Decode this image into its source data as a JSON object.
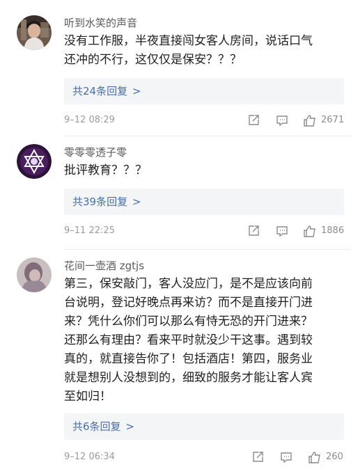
{
  "comments": [
    {
      "username": "听到水笑的声音",
      "lines": [
        "没有工作服，半夜直接闯女客人房间，说话口气",
        "还冲的不行，这仅仅是保安？？？"
      ],
      "replies": "共24条回复",
      "date": "9–12 08:29",
      "likes": "2671"
    },
    {
      "username": "零零零透子零",
      "lines": [
        "批评教育？？？"
      ],
      "replies": "共39条回复",
      "date": "9–11 22:25",
      "likes": "1886"
    },
    {
      "username": "花间一壶酒 zgtjs",
      "lines": [
        "第三，保安敲门，客人没应门，是不是应该向前",
        "台说明，登记好晚点再来访？而不是直接开门进",
        "来？凭什么你们可以那么有恃无恐的开门进来？",
        "还那么有理由？看来平时就没少干这事。遇到较",
        "真的，就直接告你了！包括酒店！第四，服务业",
        "就是想别人没想到的，细致的服务才能让客人宾",
        "至如归！"
      ],
      "replies": "共6条回复",
      "date": "9–12 06:34",
      "likes": "260"
    }
  ],
  "chevron": ">",
  "icons": {
    "share": "share-icon",
    "reply": "comment-icon",
    "like": "thumbs-up-icon"
  },
  "colors": {
    "link": "#4a6fa5",
    "meta": "#9b9b9b",
    "reply_bg": "#f4f5f7"
  }
}
